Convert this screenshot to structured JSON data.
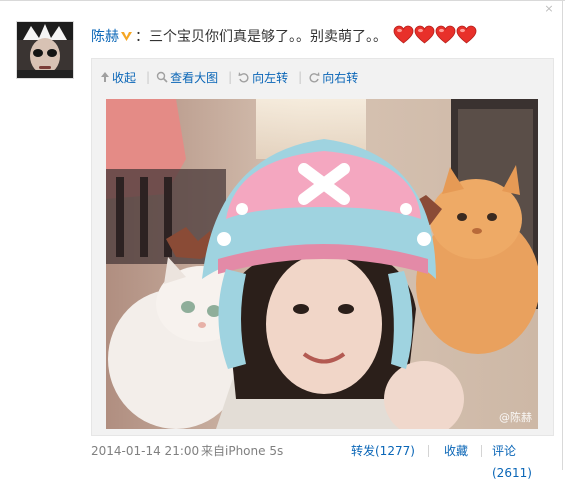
{
  "post": {
    "author": "陈赫",
    "text": "：三个宝贝你们真是够了。。别卖萌了。。",
    "emoji": [
      "heart",
      "heart",
      "heart",
      "heart"
    ]
  },
  "toolbar": {
    "collapse": "收起",
    "view_large": "查看大图",
    "rotate_left": "向左转",
    "rotate_right": "向右转"
  },
  "photo": {
    "watermark": "@陈赫"
  },
  "footer": {
    "timestamp": "2014-01-14 21:00",
    "source": "来自iPhone 5s",
    "repost": "转发(1277)",
    "favorite": "收藏",
    "comment": "评论(2611)"
  },
  "colors": {
    "link": "#0a66b7",
    "meta": "#808080",
    "heart": "#e8302a"
  }
}
